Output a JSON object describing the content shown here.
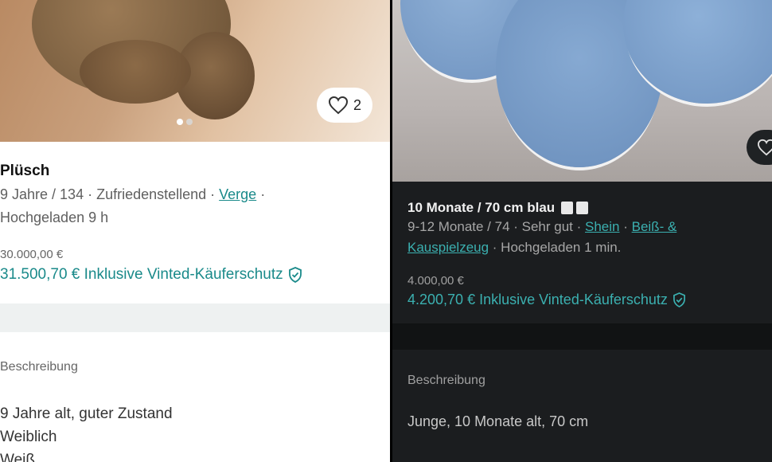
{
  "left": {
    "favorites": {
      "count": "2"
    },
    "title": "Plüsch",
    "meta": {
      "line1_prefix": "9 Jahre / 134 · Zufriedenstellend · ",
      "brand": "Verge",
      "line1_suffix": " ·",
      "line2": "Hochgeladen 9 h"
    },
    "price": "30.000,00 €",
    "price_with_protection": "31.500,70 € Inklusive Vinted-Käuferschutz",
    "description_label": "Beschreibung",
    "description_lines": [
      "9 Jahre alt, guter Zustand",
      "Weiblich",
      "Weiß"
    ]
  },
  "right": {
    "title": "10 Monate / 70 cm blau",
    "title_badges": [
      "🂠",
      "🂠"
    ],
    "meta": {
      "line1_prefix": "9-12 Monate / 74 · Sehr gut · ",
      "brand": "Shein",
      "sep": " · ",
      "category_part1": "Beiß- &",
      "category_part2": "Kauspielzeug",
      "line2_suffix": " · Hochgeladen 1 min."
    },
    "price": "4.000,00 €",
    "price_with_protection": "4.200,70 € Inklusive Vinted-Käuferschutz",
    "description_label": "Beschreibung",
    "description": "Junge, 10 Monate alt, 70 cm"
  },
  "colors": {
    "accent": "#1a8a8a",
    "accent_dark_mode": "#3bb0b0",
    "muted_light": "#5f5f5f",
    "muted_dark": "#a6a6a6"
  }
}
